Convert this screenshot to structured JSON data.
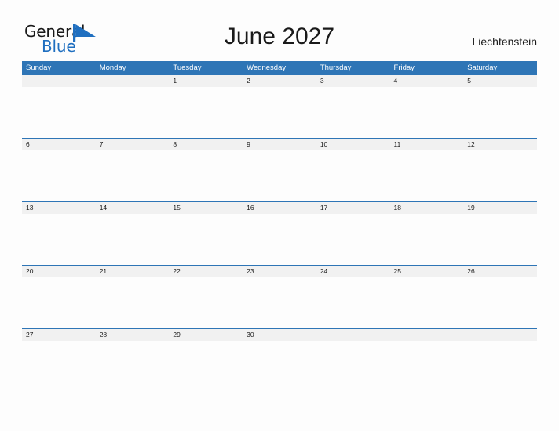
{
  "logo": {
    "word_one": "General",
    "word_two": "Blue",
    "flag_icon": "blue-flag-triangle-icon",
    "colors": {
      "general": "#1a1a1a",
      "blue": "#1f6fc0",
      "flag": "#1f6fc0"
    }
  },
  "header": {
    "title": "June 2027",
    "country": "Liechtenstein"
  },
  "calendar": {
    "colors": {
      "header_background": "#2e75b6",
      "header_text": "#ffffff",
      "day_band": "#f1f1f1",
      "separator": "#2e75b6",
      "page_background": "#fdfdfd",
      "text": "#1a1a1a"
    },
    "weekdays": [
      "Sunday",
      "Monday",
      "Tuesday",
      "Wednesday",
      "Thursday",
      "Friday",
      "Saturday"
    ],
    "weeks": [
      {
        "days": [
          "",
          "",
          "1",
          "2",
          "3",
          "4",
          "5"
        ]
      },
      {
        "days": [
          "6",
          "7",
          "8",
          "9",
          "10",
          "11",
          "12"
        ]
      },
      {
        "days": [
          "13",
          "14",
          "15",
          "16",
          "17",
          "18",
          "19"
        ]
      },
      {
        "days": [
          "20",
          "21",
          "22",
          "23",
          "24",
          "25",
          "26"
        ]
      },
      {
        "days": [
          "27",
          "28",
          "29",
          "30",
          "",
          "",
          ""
        ]
      }
    ]
  }
}
